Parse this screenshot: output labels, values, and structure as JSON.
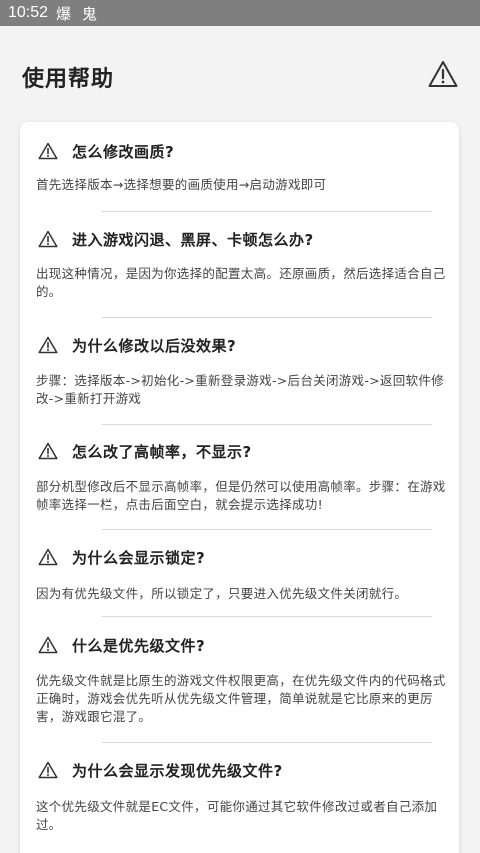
{
  "status_bar": {
    "time": "10:52",
    "icons": "爆 鬼"
  },
  "header": {
    "title": "使用帮助",
    "warning_icon": "warning-icon"
  },
  "faq": [
    {
      "question": "怎么修改画质?",
      "answer": "首先选择版本→选择想要的画质使用→启动游戏即可"
    },
    {
      "question": "进入游戏闪退、黑屏、卡顿怎么办?",
      "answer": "出现这种情况，是因为你选择的配置太高。还原画质，然后选择适合自己的。"
    },
    {
      "question": "为什么修改以后没效果?",
      "answer": "步骤：选择版本->初始化->重新登录游戏->后台关闭游戏->返回软件修改->重新打开游戏"
    },
    {
      "question": "怎么改了高帧率，不显示?",
      "answer": "部分机型修改后不显示高帧率，但是仍然可以使用高帧率。步骤：在游戏帧率选择一栏，点击后面空白，就会提示选择成功!"
    },
    {
      "question": "为什么会显示锁定?",
      "answer": "因为有优先级文件，所以锁定了，只要进入优先级文件关闭就行。"
    },
    {
      "question": "什么是优先级文件?",
      "answer": "优先级文件就是比原生的游戏文件权限更高，在优先级文件内的代码格式正确时，游戏会优先听从优先级文件管理，简单说就是它比原来的更厉害，游戏跟它混了。"
    },
    {
      "question": "为什么会显示发现优先级文件?",
      "answer": "这个优先级文件就是EC文件，可能你通过其它软件修改过或者自己添加过。"
    }
  ],
  "colors": {
    "status_bar": "#7f7f7f",
    "background": "#f3f3f3",
    "card": "#ffffff",
    "divider": "#d9d9d9"
  }
}
